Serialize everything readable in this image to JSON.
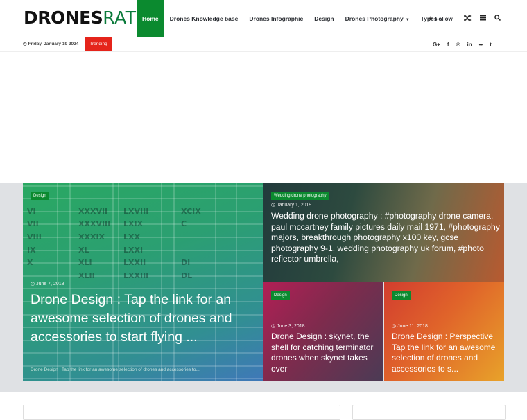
{
  "header": {
    "logo_bold": "DRONES",
    "logo_light": "RATE",
    "nav": [
      {
        "label": "Home",
        "active": true,
        "has_dropdown": false
      },
      {
        "label": "Drones Knowledge base",
        "active": false,
        "has_dropdown": false
      },
      {
        "label": "Drones Infographic",
        "active": false,
        "has_dropdown": false
      },
      {
        "label": "Design",
        "active": false,
        "has_dropdown": false
      },
      {
        "label": "Drones Photography",
        "active": false,
        "has_dropdown": true
      },
      {
        "label": "Types",
        "active": false,
        "has_dropdown": true
      }
    ],
    "follow_label": "Follow",
    "icons": [
      "plus-icon",
      "shuffle-icon",
      "menu-icon",
      "search-icon"
    ]
  },
  "topbar": {
    "date": "Friday, January 19 2024",
    "trending_label": "Trending",
    "social": [
      "google-plus-icon",
      "facebook-icon",
      "pinterest-icon",
      "linkedin-icon",
      "flickr-icon",
      "tumblr-icon"
    ]
  },
  "featured": [
    {
      "category": "Design",
      "date": "June 7, 2018",
      "title": "Drone Design : Tap the link for an awesome selection of drones and accessories to start flying ...",
      "excerpt": "Drone Design : Tap the link for an awesome selection of drones and accessories to..."
    },
    {
      "category": "Wedding drone photography",
      "date": "January 1, 2019",
      "title": "Wedding drone photography : #photography drone camera, paul mccartney family pictures daily mail 1971, #photography majors, breakthrough photography x100 key, gcse photography 9-1, wedding photography uk forum, #photo reflector umbrella,"
    },
    {
      "category": "Design",
      "date": "June 3, 2018",
      "title": "Drone Design : skynet, the shell for catching terminator drones when skynet takes over"
    },
    {
      "category": "Design",
      "date": "June 11, 2018",
      "title": "Drone Design : Perspective Tap the link for an awesome selection of drones and accessories to s..."
    }
  ],
  "colors": {
    "accent": "#0b8a2f",
    "trending": "#e5241b",
    "text_dark": "#2c2f34",
    "grid_bg": "#dfe1e4"
  }
}
